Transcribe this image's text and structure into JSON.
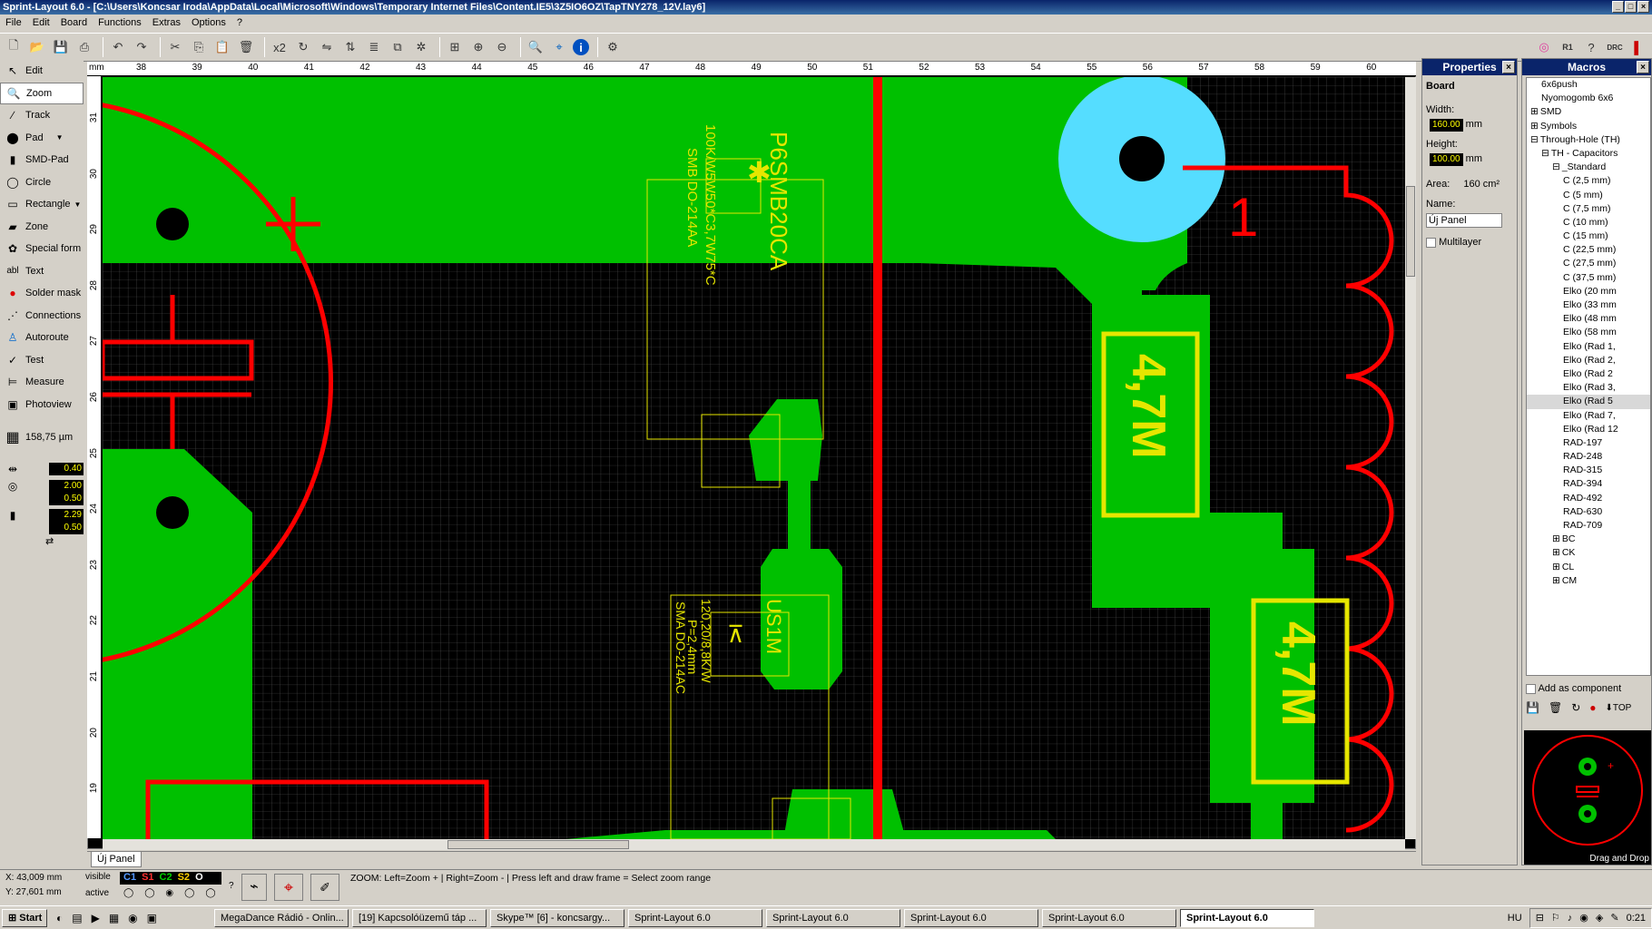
{
  "window": {
    "title": "Sprint-Layout 6.0 - [C:\\Users\\Koncsar Iroda\\AppData\\Local\\Microsoft\\Windows\\Temporary Internet Files\\Content.IE5\\3Z5IO6OZ\\TapTNY278_12V.lay6]"
  },
  "menu": [
    "File",
    "Edit",
    "Board",
    "Functions",
    "Extras",
    "Options",
    "?"
  ],
  "toolbar": {
    "x2_label": "x2",
    "top_label": "TOP"
  },
  "tools": [
    {
      "label": "Edit",
      "icon": "cursor-icon"
    },
    {
      "label": "Zoom",
      "icon": "magnifier-icon"
    },
    {
      "label": "Track",
      "icon": "track-icon"
    },
    {
      "label": "Pad",
      "icon": "pad-icon"
    },
    {
      "label": "SMD-Pad",
      "icon": "smd-pad-icon"
    },
    {
      "label": "Circle",
      "icon": "circle-icon"
    },
    {
      "label": "Rectangle",
      "icon": "rectangle-icon"
    },
    {
      "label": "Zone",
      "icon": "zone-icon"
    },
    {
      "label": "Special form",
      "icon": "special-form-icon"
    },
    {
      "label": "Text",
      "icon": "text-icon"
    },
    {
      "label": "Solder mask",
      "icon": "solder-mask-icon"
    },
    {
      "label": "Connections",
      "icon": "connections-icon"
    },
    {
      "label": "Autoroute",
      "icon": "autoroute-icon"
    },
    {
      "label": "Test",
      "icon": "test-icon"
    },
    {
      "label": "Measure",
      "icon": "measure-icon"
    },
    {
      "label": "Photoview",
      "icon": "photoview-icon"
    }
  ],
  "grid": {
    "value": "158,75 µm"
  },
  "widths": {
    "track": "0.40",
    "pad_outer": "2.00",
    "pad_inner": "0.50",
    "smd_w": "2.29",
    "smd_h": "0.50"
  },
  "ruler": {
    "x_labels": [
      "mm",
      "38",
      "39",
      "40",
      "41",
      "42",
      "43",
      "44",
      "45",
      "46",
      "47",
      "48",
      "49",
      "50",
      "51",
      "52",
      "53",
      "54",
      "55",
      "56",
      "57",
      "58",
      "59",
      "60"
    ],
    "y_labels": [
      "31",
      "30",
      "29",
      "28",
      "27",
      "26",
      "25",
      "24",
      "23",
      "22",
      "21",
      "20",
      "19"
    ]
  },
  "pcb_text": {
    "p6smb": "P6SMB20CA",
    "p6smb_desc1": "100K/W5W50*C3,7W75*C",
    "p6smb_desc2": "SMB DO-214AA",
    "us1m": "US1M",
    "us1m_desc1": "120,20/8,8K/W",
    "us1m_desc2": "P=2,4mm",
    "us1m_desc3": "SMA DO-214AC",
    "cap1": "4,7M",
    "cap2": "4,7M",
    "pin1": "1"
  },
  "tab": {
    "label": "Új Panel"
  },
  "properties": {
    "title": "Properties",
    "section": "Board",
    "width_label": "Width:",
    "width_value": "160.00",
    "height_label": "Height:",
    "height_value": "100.00",
    "unit": "mm",
    "area_label": "Area:",
    "area_value": "160 cm²",
    "name_label": "Name:",
    "name_value": "Új Panel",
    "multilayer_label": "Multilayer"
  },
  "macros": {
    "title": "Macros",
    "tree": [
      {
        "label": "6x6push",
        "indent": 1
      },
      {
        "label": "Nyomogomb 6x6",
        "indent": 1
      },
      {
        "label": "SMD",
        "indent": 0,
        "expander": "+"
      },
      {
        "label": "Symbols",
        "indent": 0,
        "expander": "+"
      },
      {
        "label": "Through-Hole (TH)",
        "indent": 0,
        "expander": "-"
      },
      {
        "label": "TH - Capacitors",
        "indent": 1,
        "expander": "-"
      },
      {
        "label": "_Standard",
        "indent": 2,
        "expander": "-"
      },
      {
        "label": "C (2,5 mm)",
        "indent": 3
      },
      {
        "label": "C (5 mm)",
        "indent": 3
      },
      {
        "label": "C (7,5 mm)",
        "indent": 3
      },
      {
        "label": "C (10 mm)",
        "indent": 3
      },
      {
        "label": "C (15 mm)",
        "indent": 3
      },
      {
        "label": "C (22,5 mm)",
        "indent": 3
      },
      {
        "label": "C (27,5 mm)",
        "indent": 3
      },
      {
        "label": "C (37,5 mm)",
        "indent": 3
      },
      {
        "label": "Elko (20 mm",
        "indent": 3
      },
      {
        "label": "Elko (33 mm",
        "indent": 3
      },
      {
        "label": "Elko (48 mm",
        "indent": 3
      },
      {
        "label": "Elko (58 mm",
        "indent": 3
      },
      {
        "label": "Elko (Rad 1,",
        "indent": 3
      },
      {
        "label": "Elko (Rad 2,",
        "indent": 3
      },
      {
        "label": "Elko (Rad 2",
        "indent": 3
      },
      {
        "label": "Elko (Rad 3,",
        "indent": 3
      },
      {
        "label": "Elko (Rad 5",
        "indent": 3,
        "selected": true
      },
      {
        "label": "Elko (Rad 7,",
        "indent": 3
      },
      {
        "label": "Elko (Rad 12",
        "indent": 3
      },
      {
        "label": "RAD-197",
        "indent": 3
      },
      {
        "label": "RAD-248",
        "indent": 3
      },
      {
        "label": "RAD-315",
        "indent": 3
      },
      {
        "label": "RAD-394",
        "indent": 3
      },
      {
        "label": "RAD-492",
        "indent": 3
      },
      {
        "label": "RAD-630",
        "indent": 3
      },
      {
        "label": "RAD-709",
        "indent": 3
      },
      {
        "label": "BC",
        "indent": 2,
        "expander": "+"
      },
      {
        "label": "CK",
        "indent": 2,
        "expander": "+"
      },
      {
        "label": "CL",
        "indent": 2,
        "expander": "+"
      },
      {
        "label": "CM",
        "indent": 2,
        "expander": "+"
      }
    ],
    "add_as_component": "Add as component",
    "drag_drop": "Drag and Drop"
  },
  "status": {
    "x": "X:    43,009 mm",
    "y": "Y:    27,601 mm",
    "visible": "visible",
    "active": "active",
    "layers": [
      "C1",
      "S1",
      "C2",
      "S2",
      "O"
    ],
    "help": "ZOOM:  Left=Zoom +  |  Right=Zoom -  |  Press left and draw frame = Select zoom range"
  },
  "taskbar": {
    "start": "Start",
    "tasks": [
      "MegaDance Rádió - Onlin...",
      "[19] Kapcsolóüzemű táp ...",
      "Skype™ [6] - koncsargy...",
      "Sprint-Layout 6.0",
      "Sprint-Layout 6.0",
      "Sprint-Layout 6.0",
      "Sprint-Layout 6.0",
      "Sprint-Layout 6.0"
    ],
    "lang": "HU",
    "time": "0:21"
  },
  "colors": {
    "copper": "#00c000",
    "board": "#000000",
    "trace": "#ff0000",
    "silk": "#e6e600",
    "hole": "#000000",
    "pad_selected": "#55ddff"
  }
}
